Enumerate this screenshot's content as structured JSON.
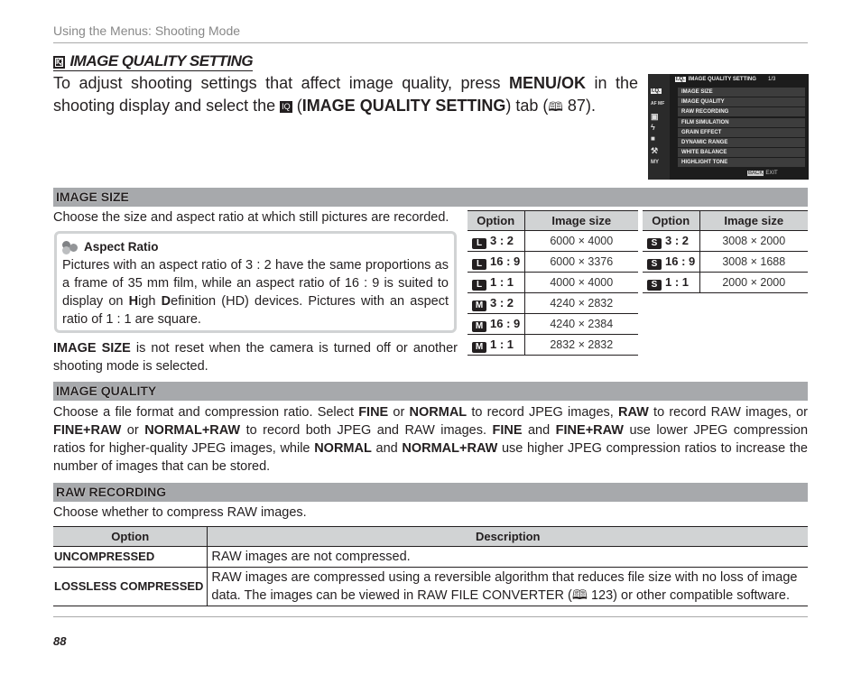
{
  "running_head": "Using the Menus: Shooting Mode",
  "section": {
    "tab_icon": "IQ",
    "title": "IMAGE QUALITY SETTING",
    "intro_parts": [
      "To adjust shooting settings that affect image quality, press ",
      "MENU/OK",
      " in the shooting display and select the ",
      "IQ",
      " (",
      "IMAGE QUALITY SETTING",
      ") tab (",
      "87",
      ")."
    ]
  },
  "camera_screen": {
    "title": "IMAGE QUALITY SETTING",
    "title_icon": "I.Q.",
    "page": "1/3",
    "side_icons": [
      "I.Q.",
      "AF MF",
      "camera",
      "flash",
      "movie",
      "wrench",
      "MY"
    ],
    "items": [
      "IMAGE SIZE",
      "IMAGE QUALITY",
      "RAW RECORDING",
      "FILM SIMULATION",
      "GRAIN EFFECT",
      "DYNAMIC RANGE",
      "WHITE BALANCE",
      "HIGHLIGHT TONE"
    ],
    "footer_button": "BACK",
    "footer_label": "EXIT"
  },
  "image_size": {
    "heading": "IMAGE SIZE",
    "description": "Choose the size and aspect ratio at which still pictures are recorded.",
    "hint": {
      "title": "Aspect Ratio",
      "text_parts": [
        "Pictures with an aspect ratio of 3 : 2 have the same proportions as a frame of 35 mm film, while an aspect ratio of 16 : 9 is suited to display on ",
        "H",
        "igh ",
        "D",
        "efinition (HD) devices.  Pictures with an aspect ratio of 1 : 1 are square."
      ]
    },
    "note_bold": "IMAGE SIZE",
    "note_rest": " is not reset when the camera is turned off or another shooting mode is selected.",
    "table_headers": [
      "Option",
      "Image size"
    ],
    "table_left": [
      {
        "badge": "L",
        "ratio": "3 : 2",
        "size": "6000 × 4000"
      },
      {
        "badge": "L",
        "ratio": "16 : 9",
        "size": "6000 × 3376"
      },
      {
        "badge": "L",
        "ratio": "1 : 1",
        "size": "4000 × 4000"
      },
      {
        "badge": "M",
        "ratio": "3 : 2",
        "size": "4240 × 2832"
      },
      {
        "badge": "M",
        "ratio": "16 : 9",
        "size": "4240 × 2384"
      },
      {
        "badge": "M",
        "ratio": "1 : 1",
        "size": "2832 × 2832"
      }
    ],
    "table_right": [
      {
        "badge": "S",
        "ratio": "3 : 2",
        "size": "3008 × 2000"
      },
      {
        "badge": "S",
        "ratio": "16 : 9",
        "size": "3008 × 1688"
      },
      {
        "badge": "S",
        "ratio": "1 : 1",
        "size": "2000 × 2000"
      }
    ]
  },
  "image_quality": {
    "heading": "IMAGE QUALITY",
    "text_parts": [
      {
        "t": "Choose a file format and compression ratio.  Select ",
        "b": false
      },
      {
        "t": "FINE",
        "b": true
      },
      {
        "t": " or ",
        "b": false
      },
      {
        "t": "NORMAL",
        "b": true
      },
      {
        "t": " to record JPEG images, ",
        "b": false
      },
      {
        "t": "RAW",
        "b": true
      },
      {
        "t": " to record RAW images, or ",
        "b": false
      },
      {
        "t": "FINE+RAW",
        "b": true
      },
      {
        "t": " or ",
        "b": false
      },
      {
        "t": "NORMAL+RAW",
        "b": true
      },
      {
        "t": " to record both JPEG and RAW images.  ",
        "b": false
      },
      {
        "t": "FINE",
        "b": true
      },
      {
        "t": " and ",
        "b": false
      },
      {
        "t": "FINE+RAW",
        "b": true
      },
      {
        "t": " use lower JPEG compression ratios for higher-quality JPEG images, while ",
        "b": false
      },
      {
        "t": "NORMAL",
        "b": true
      },
      {
        "t": " and ",
        "b": false
      },
      {
        "t": "NORMAL+RAW",
        "b": true
      },
      {
        "t": " use higher JPEG compression ratios to increase the num­ber of images that can be stored.",
        "b": false
      }
    ]
  },
  "raw_recording": {
    "heading": "RAW RECORDING",
    "description": "Choose whether to compress RAW images.",
    "table_headers": [
      "Option",
      "Description"
    ],
    "rows": [
      {
        "option": "UNCOMPRESSED",
        "description": "RAW images are not compressed."
      },
      {
        "option": "LOSSLESS COMPRESSED",
        "description": "RAW images are compressed using a reversible algorithm that reduces file size with no loss of image data. The images can be viewed in RAW FILE CONVERTER (🕮 123) or other compatible software."
      }
    ]
  },
  "page_number": "88"
}
